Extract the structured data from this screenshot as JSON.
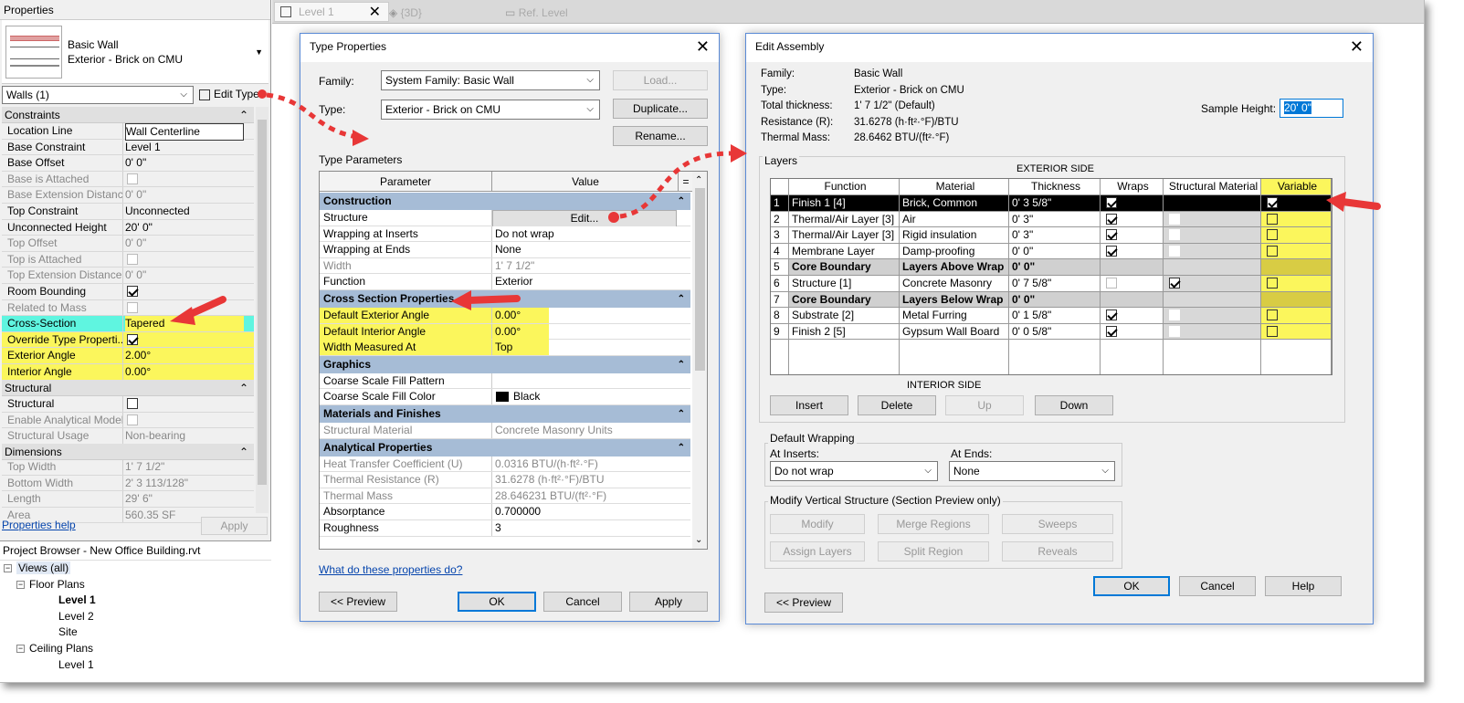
{
  "tabs": [
    {
      "label": "Level 1"
    },
    {
      "label": "{3D}"
    },
    {
      "label": "Ref. Level"
    }
  ],
  "properties": {
    "title": "Properties",
    "type_name": "Basic Wall",
    "type_sub": "Exterior - Brick on CMU",
    "selector": "Walls (1)",
    "edit_type": "Edit Type",
    "sections": {
      "constraints": "Constraints",
      "structural": "Structural",
      "dimensions": "Dimensions"
    },
    "rows": [
      {
        "k": "Location Line",
        "v": "Wall Centerline"
      },
      {
        "k": "Base Constraint",
        "v": "Level 1"
      },
      {
        "k": "Base Offset",
        "v": "0'  0\""
      },
      {
        "k": "Base is Attached",
        "v": ""
      },
      {
        "k": "Base Extension Distance",
        "v": "0'  0\""
      },
      {
        "k": "Top Constraint",
        "v": "Unconnected"
      },
      {
        "k": "Unconnected Height",
        "v": "20'  0\""
      },
      {
        "k": "Top Offset",
        "v": "0'  0\""
      },
      {
        "k": "Top is Attached",
        "v": ""
      },
      {
        "k": "Top Extension Distance",
        "v": "0'  0\""
      },
      {
        "k": "Room Bounding",
        "v": ""
      },
      {
        "k": "Related to Mass",
        "v": ""
      },
      {
        "k": "Cross-Section",
        "v": "Tapered"
      },
      {
        "k": "Override Type Properti...",
        "v": ""
      },
      {
        "k": "Exterior Angle",
        "v": "2.00°"
      },
      {
        "k": "Interior Angle",
        "v": "0.00°"
      },
      {
        "k": "Structural",
        "v": ""
      },
      {
        "k": "Enable Analytical Model",
        "v": ""
      },
      {
        "k": "Structural Usage",
        "v": "Non-bearing"
      },
      {
        "k": "Top Width",
        "v": "1'  7 1/2\""
      },
      {
        "k": "Bottom Width",
        "v": "2'  3 113/128\""
      },
      {
        "k": "Length",
        "v": "29'  6\""
      },
      {
        "k": "Area",
        "v": "560.35 SF"
      }
    ],
    "help_link": "Properties help",
    "apply": "Apply"
  },
  "project_browser": {
    "title": "Project Browser - New Office Building.rvt",
    "items": [
      {
        "label": "Views (all)"
      },
      {
        "label": "Floor Plans"
      },
      {
        "label": "Level 1"
      },
      {
        "label": "Level 2"
      },
      {
        "label": "Site"
      },
      {
        "label": "Ceiling Plans"
      },
      {
        "label": "Level 1"
      }
    ]
  },
  "type_properties": {
    "title": "Type Properties",
    "family_label": "Family:",
    "family_value": "System Family: Basic Wall",
    "type_label": "Type:",
    "type_value": "Exterior - Brick on CMU",
    "load": "Load...",
    "duplicate": "Duplicate...",
    "rename": "Rename...",
    "type_params": "Type Parameters",
    "col_param": "Parameter",
    "col_value": "Value",
    "col_eq": "=",
    "groups": {
      "construction": "Construction",
      "cross": "Cross Section Properties",
      "graphics": "Graphics",
      "materials": "Materials and Finishes",
      "analytical": "Analytical Properties"
    },
    "rows": [
      {
        "k": "Structure",
        "v": "Edit..."
      },
      {
        "k": "Wrapping at Inserts",
        "v": "Do not wrap"
      },
      {
        "k": "Wrapping at Ends",
        "v": "None"
      },
      {
        "k": "Width",
        "v": "1'  7 1/2\""
      },
      {
        "k": "Function",
        "v": "Exterior"
      },
      {
        "k": "Default Exterior Angle",
        "v": "0.00°"
      },
      {
        "k": "Default Interior Angle",
        "v": "0.00°"
      },
      {
        "k": "Width Measured At",
        "v": "Top"
      },
      {
        "k": "Coarse Scale Fill Pattern",
        "v": ""
      },
      {
        "k": "Coarse Scale Fill Color",
        "v": "Black"
      },
      {
        "k": "Structural Material",
        "v": "Concrete Masonry Units"
      },
      {
        "k": "Heat Transfer Coefficient (U)",
        "v": "0.0316 BTU/(h·ft²·°F)"
      },
      {
        "k": "Thermal Resistance (R)",
        "v": "31.6278 (h·ft²·°F)/BTU"
      },
      {
        "k": "Thermal Mass",
        "v": "28.646231 BTU/(ft²·°F)"
      },
      {
        "k": "Absorptance",
        "v": "0.700000"
      },
      {
        "k": "Roughness",
        "v": "3"
      }
    ],
    "help_link": "What do these properties do?",
    "preview": "<< Preview",
    "ok": "OK",
    "cancel": "Cancel",
    "apply": "Apply"
  },
  "edit_assembly": {
    "title": "Edit Assembly",
    "info": [
      {
        "k": "Family:",
        "v": "Basic Wall"
      },
      {
        "k": "Type:",
        "v": "Exterior - Brick on CMU"
      },
      {
        "k": "Total thickness:",
        "v": "1'  7 1/2\" (Default)"
      },
      {
        "k": "Resistance (R):",
        "v": "31.6278 (h·ft²·°F)/BTU"
      },
      {
        "k": "Thermal Mass:",
        "v": "28.6462 BTU/(ft²·°F)"
      }
    ],
    "sample_height_label": "Sample Height:",
    "sample_height_value": "20'  0\"",
    "layers_label": "Layers",
    "exterior_side": "EXTERIOR SIDE",
    "interior_side": "INTERIOR SIDE",
    "columns": [
      "Function",
      "Material",
      "Thickness",
      "Wraps",
      "Structural Material",
      "Variable"
    ],
    "rows": [
      {
        "n": "1",
        "f": "Finish 1 [4]",
        "m": "Brick, Common",
        "t": "0'  3 5/8\""
      },
      {
        "n": "2",
        "f": "Thermal/Air Layer [3]",
        "m": "Air",
        "t": "0'  3\""
      },
      {
        "n": "3",
        "f": "Thermal/Air Layer [3]",
        "m": "Rigid insulation",
        "t": "0'  3\""
      },
      {
        "n": "4",
        "f": "Membrane Layer",
        "m": "Damp-proofing",
        "t": "0'  0\""
      },
      {
        "n": "5",
        "f": "Core Boundary",
        "m": "Layers Above Wrap",
        "t": "0'  0\""
      },
      {
        "n": "6",
        "f": "Structure [1]",
        "m": "Concrete Masonry",
        "t": "0'  7 5/8\""
      },
      {
        "n": "7",
        "f": "Core Boundary",
        "m": "Layers Below Wrap",
        "t": "0'  0\""
      },
      {
        "n": "8",
        "f": "Substrate [2]",
        "m": "Metal Furring",
        "t": "0'  1 5/8\""
      },
      {
        "n": "9",
        "f": "Finish 2 [5]",
        "m": "Gypsum Wall Board",
        "t": "0'  0 5/8\""
      }
    ],
    "insert": "Insert",
    "delete": "Delete",
    "up": "Up",
    "down": "Down",
    "default_wrapping": "Default Wrapping",
    "at_inserts": "At Inserts:",
    "at_inserts_value": "Do not wrap",
    "at_ends": "At  Ends:",
    "at_ends_value": "None",
    "modify_vertical": "Modify Vertical Structure (Section Preview only)",
    "modify": "Modify",
    "merge_regions": "Merge Regions",
    "sweeps": "Sweeps",
    "assign_layers": "Assign Layers",
    "split_region": "Split Region",
    "reveals": "Reveals",
    "ok": "OK",
    "cancel": "Cancel",
    "help": "Help",
    "preview": "<< Preview"
  },
  "colors": {
    "highlight_yellow": "#fbf65c",
    "cross_section_cyan": "#5ff5e0",
    "group_header": "#a6bcd6",
    "arrow_red": "#e83737"
  }
}
